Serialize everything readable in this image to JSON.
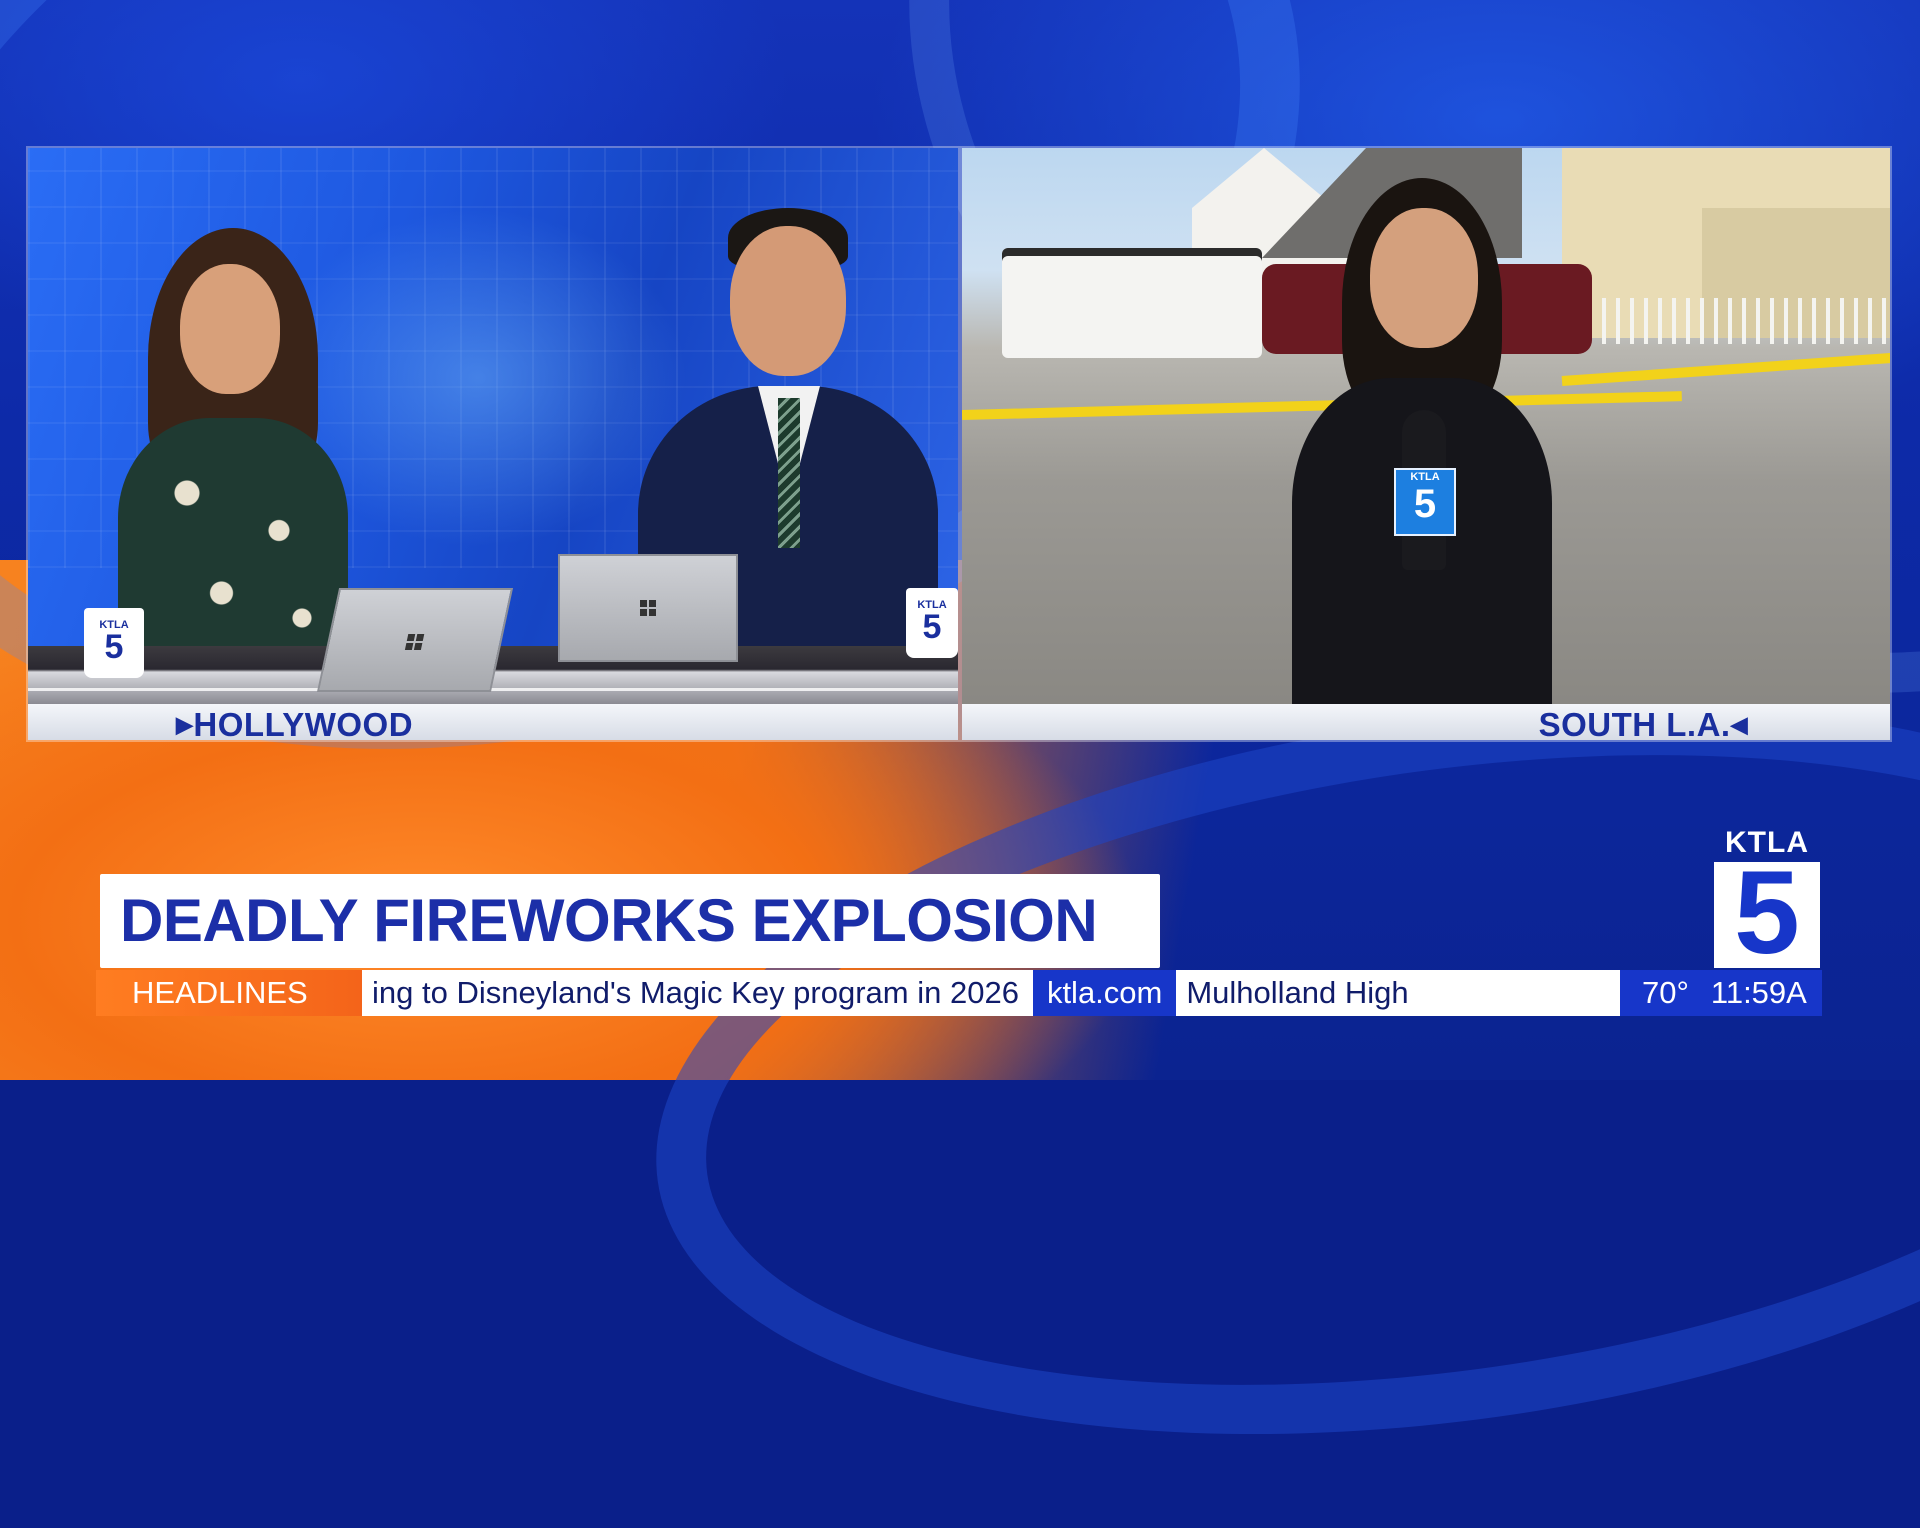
{
  "headline": "DEADLY FIREWORKS EXPLOSION",
  "locations": {
    "left": "HOLLYWOOD",
    "right": "SOUTH L.A."
  },
  "ticker": {
    "tag": "HEADLINES",
    "story": "ing to Disneyland's Magic Key program in 2026",
    "site": "ktla.com",
    "next_story": "Mulholland High",
    "temperature": "70°",
    "time": "11:59A"
  },
  "branding": {
    "station": "KTLA",
    "channel": "5",
    "mic_flag_text": "KTLA",
    "mug_text": "KTLA"
  },
  "colors": {
    "brand_blue": "#1736c9",
    "accent_orange": "#f4641a",
    "headline_text": "#1c2fa8"
  },
  "icons": {
    "location_left_marker": "triangle-right-icon",
    "location_right_marker": "triangle-left-icon",
    "laptop_brand": "windows-logo-icon"
  }
}
